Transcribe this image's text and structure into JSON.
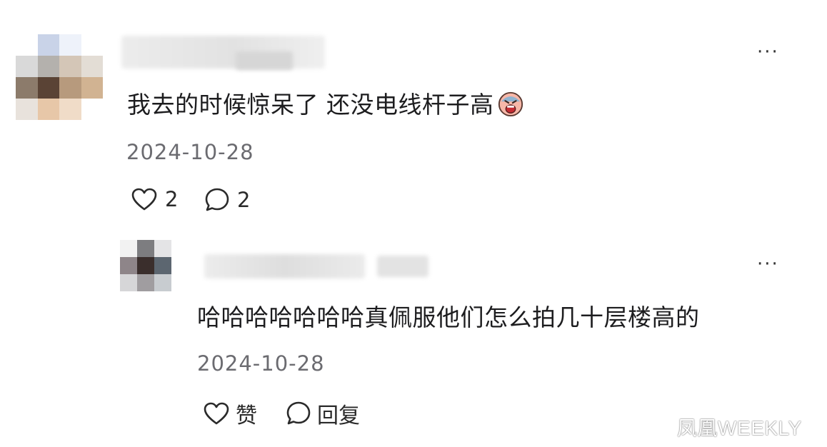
{
  "comment": {
    "text": "我去的时候惊呆了 还没电线杆子高",
    "emoji_icon": "crying-face-icon",
    "date": "2024-10-28",
    "like_count": "2",
    "reply_count": "2"
  },
  "reply": {
    "text": "哈哈哈哈哈哈哈真佩服他们怎么拍几十层楼高的",
    "date": "2024-10-28",
    "like_label": "赞",
    "reply_label": "回复"
  },
  "more_label": "···",
  "watermark": "凤凰WEEKLY",
  "colors": {
    "date_text": "#6b6b70",
    "body_text": "#1d1d1f",
    "icon": "#2a2a2a",
    "background": "#ffffff"
  }
}
